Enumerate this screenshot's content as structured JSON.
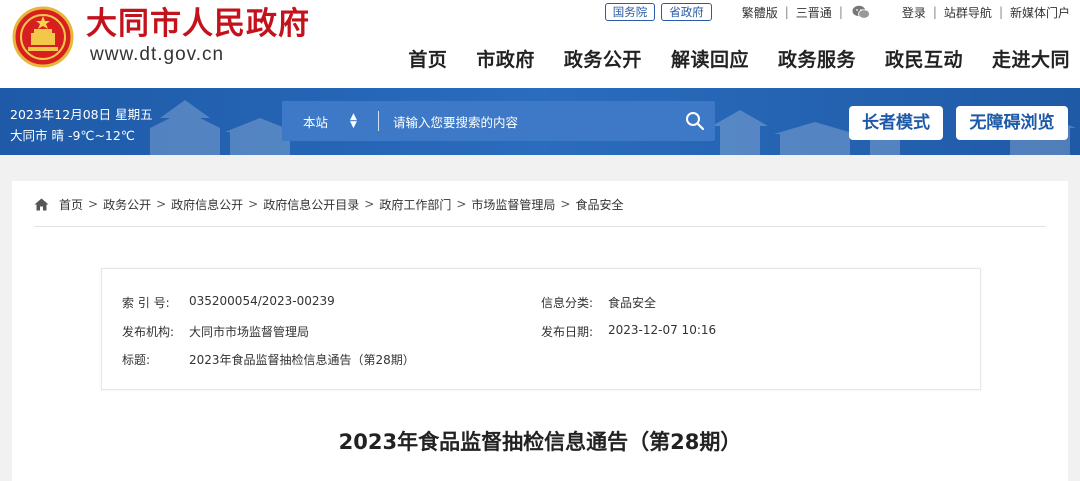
{
  "header": {
    "site_title": "大同市人民政府",
    "site_domain": "www.dt.gov.cn",
    "top_links": {
      "pill1": "国务院",
      "pill2": "省政府",
      "traditional": "繁體版",
      "sanjin": "三晋通",
      "login": "登录",
      "sitemap": "站群导航",
      "newmedia": "新媒体门户"
    },
    "nav": [
      "首页",
      "市政府",
      "政务公开",
      "解读回应",
      "政务服务",
      "政民互动",
      "走进大同"
    ]
  },
  "banner": {
    "date": "2023年12月08日 星期五",
    "weather": "大同市 晴 -9℃~12℃",
    "search": {
      "scope": "本站",
      "placeholder": "请输入您要搜索的内容"
    },
    "elder_mode": "长者模式",
    "accessibility": "无障碍浏览"
  },
  "breadcrumb": [
    "首页",
    "政务公开",
    "政府信息公开",
    "政府信息公开目录",
    "政府工作部门",
    "市场监督管理局",
    "食品安全"
  ],
  "meta": {
    "index_label": "索 引 号:",
    "index_value": "035200054/2023-00239",
    "category_label": "信息分类:",
    "category_value": "食品安全",
    "publisher_label": "发布机构:",
    "publisher_value": "大同市市场监督管理局",
    "date_label": "发布日期:",
    "date_value": "2023-12-07 10:16",
    "title_label": "标题:",
    "title_value": "2023年食品监督抽检信息通告（第28期）"
  },
  "article": {
    "title": "2023年食品监督抽检信息通告（第28期）"
  },
  "colors": {
    "brand_red": "#c4121c",
    "banner_blue": "#1e5aa8",
    "page_bg": "#f1f1f1"
  },
  "icons": [
    "national-emblem-icon",
    "wechat-icon",
    "search-icon",
    "home-icon",
    "sort-arrows-icon"
  ]
}
